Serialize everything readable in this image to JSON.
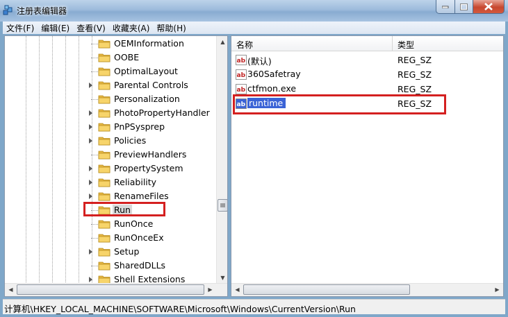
{
  "window": {
    "title": "注册表编辑器"
  },
  "menu": [
    "文件(F)",
    "编辑(E)",
    "查看(V)",
    "收藏夹(A)",
    "帮助(H)"
  ],
  "tree": [
    {
      "label": "OEMInformation",
      "expandable": false
    },
    {
      "label": "OOBE",
      "expandable": false
    },
    {
      "label": "OptimalLayout",
      "expandable": false
    },
    {
      "label": "Parental Controls",
      "expandable": true
    },
    {
      "label": "Personalization",
      "expandable": false
    },
    {
      "label": "PhotoPropertyHandler",
      "expandable": true
    },
    {
      "label": "PnPSysprep",
      "expandable": true
    },
    {
      "label": "Policies",
      "expandable": true
    },
    {
      "label": "PreviewHandlers",
      "expandable": false
    },
    {
      "label": "PropertySystem",
      "expandable": true
    },
    {
      "label": "Reliability",
      "expandable": true
    },
    {
      "label": "RenameFiles",
      "expandable": true
    },
    {
      "label": "Run",
      "expandable": false,
      "selected": true
    },
    {
      "label": "RunOnce",
      "expandable": false
    },
    {
      "label": "RunOnceEx",
      "expandable": false
    },
    {
      "label": "Setup",
      "expandable": true
    },
    {
      "label": "SharedDLLs",
      "expandable": false
    },
    {
      "label": "Shell Extensions",
      "expandable": true
    }
  ],
  "columns": {
    "name": "名称",
    "type": "类型"
  },
  "values": [
    {
      "name": "(默认)",
      "type": "REG_SZ"
    },
    {
      "name": "360Safetray",
      "type": "REG_SZ"
    },
    {
      "name": "ctfmon.exe",
      "type": "REG_SZ"
    },
    {
      "name": "runtime",
      "type": "REG_SZ",
      "selected": true
    }
  ],
  "status": {
    "path": "计算机\\HKEY_LOCAL_MACHINE\\SOFTWARE\\Microsoft\\Windows\\CurrentVersion\\Run"
  },
  "colors": {
    "highlight_box": "#d42020",
    "selection": "#3b63d6"
  }
}
